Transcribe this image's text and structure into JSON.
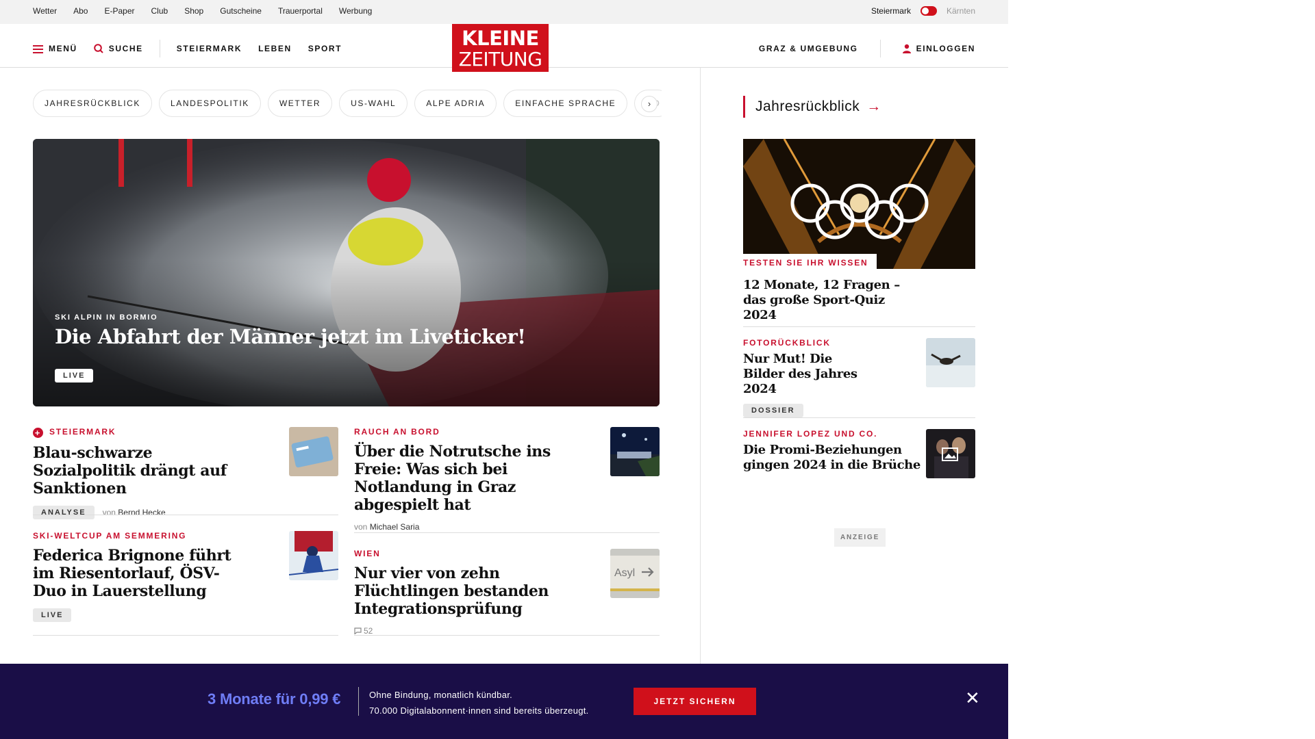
{
  "utility": {
    "links": [
      "Wetter",
      "Abo",
      "E-Paper",
      "Club",
      "Shop",
      "Gutscheine",
      "Trauerportal",
      "Werbung"
    ],
    "region_active": "Steiermark",
    "region_inactive": "Kärnten"
  },
  "header": {
    "menu_label": "MENÜ",
    "search_label": "SUCHE",
    "nav": [
      "STEIERMARK",
      "LEBEN",
      "SPORT"
    ],
    "logo_line1": "KLEINE",
    "logo_line2": "ZEITUNG",
    "region_link": "GRAZ & UMGEBUNG",
    "login_label": "EINLOGGEN"
  },
  "chips": [
    "JAHRESRÜCKBLICK",
    "LANDESPOLITIK",
    "WETTER",
    "US-WAHL",
    "ALPE ADRIA",
    "EINFACHE SPRACHE",
    "DO"
  ],
  "hero": {
    "kicker": "SKI ALPIN IN BORMIO",
    "title": "Die Abfahrt der Männer jetzt im Liveticker!",
    "badge": "LIVE"
  },
  "articles": [
    {
      "kicker": "STEIERMARK",
      "headline": "Blau-schwarze Sozialpolitik drängt auf Sanktionen",
      "badge": "ANALYSE",
      "by": "von",
      "author": "Bernd Hecke"
    },
    {
      "kicker": "RAUCH AN BORD",
      "headline": "Über die Notrutsche ins Freie: Was sich bei Notlandung in Graz abgespielt hat",
      "by": "von",
      "author": "Michael Saria"
    },
    {
      "kicker": "SKI-WELTCUP AM SEMMERING",
      "headline": "Federica Brignone führt im Riesentorlauf, ÖSV-Duo in Lauerstellung",
      "badge": "LIVE"
    },
    {
      "kicker": "WIEN",
      "headline": "Nur vier von zehn Flüchtlingen bestanden Integrationsprüfung",
      "comments": "52"
    }
  ],
  "sidebar": {
    "title": "Jahresrückblick",
    "items": [
      {
        "kicker": "TESTEN SIE IHR WISSEN",
        "headline": "12 Monate, 12 Fragen – das große Sport-Quiz 2024"
      },
      {
        "kicker": "FOTORÜCKBLICK",
        "headline": "Nur Mut! Die Bilder des Jahres 2024",
        "badge": "DOSSIER"
      },
      {
        "kicker": "JENNIFER LOPEZ UND CO.",
        "headline": "Die Promi-Beziehungen gingen 2024 in die Brüche"
      }
    ],
    "ad_label": "ANZEIGE"
  },
  "banner": {
    "offer": "3 Monate für 0,99 €",
    "line1": "Ohne Bindung, monatlich kündbar.",
    "line2": "70.000 Digitalabonnent·innen sind bereits überzeugt.",
    "cta": "JETZT SICHERN"
  },
  "colors": {
    "brand_red": "#d0101b",
    "banner_bg": "#1a0e47",
    "offer_blue": "#6f7df6"
  }
}
